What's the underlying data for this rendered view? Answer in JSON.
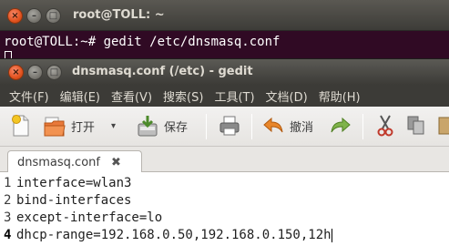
{
  "terminal": {
    "title": "root@TOLL: ~",
    "prompt": "root@TOLL:~# ",
    "command": "gedit /etc/dnsmasq.conf"
  },
  "gedit": {
    "title": "dnsmasq.conf (/etc) - gedit",
    "menu": [
      "文件(F)",
      "编辑(E)",
      "查看(V)",
      "搜索(S)",
      "工具(T)",
      "文档(D)",
      "帮助(H)"
    ],
    "toolbar": {
      "open_label": "打开",
      "save_label": "保存",
      "undo_label": "撤消"
    },
    "tab": {
      "label": "dnsmasq.conf",
      "close_glyph": "✖"
    },
    "lines": [
      {
        "number": "1",
        "text": "interface=wlan3"
      },
      {
        "number": "2",
        "text": "bind-interfaces"
      },
      {
        "number": "3",
        "text": "except-interface=lo"
      },
      {
        "number": "4",
        "text": "dhcp-range=192.168.0.50,192.168.0.150,12h"
      }
    ]
  },
  "colors": {
    "terminal_bg": "#300a24",
    "close_button": "#e2521f",
    "titlebar": "#3c3b37"
  }
}
